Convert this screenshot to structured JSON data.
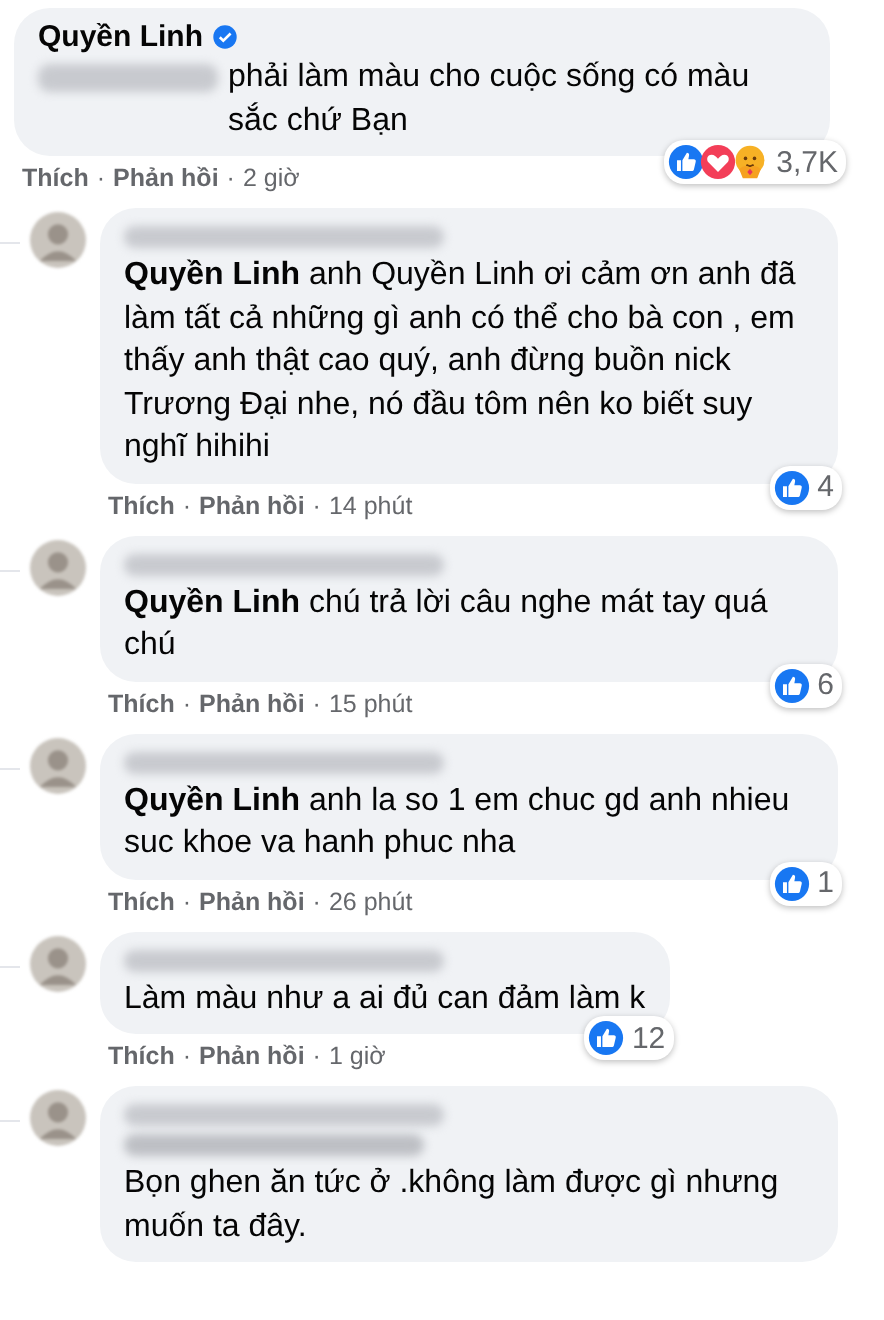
{
  "comments": [
    {
      "kind": "main",
      "author": "Quyền Linh",
      "verified": true,
      "mention_blurred": true,
      "text": "phải làm màu cho cuộc sống có màu sắc chứ Bạn",
      "reactions": [
        {
          "kind": "like"
        },
        {
          "kind": "love"
        },
        {
          "kind": "care"
        }
      ],
      "reaction_count": "3,7K",
      "actions": [
        {
          "kind": "link",
          "text": "Thích"
        },
        {
          "kind": "dot",
          "text": "·"
        },
        {
          "kind": "link",
          "text": "Phản hồi"
        },
        {
          "kind": "dot",
          "text": "·"
        },
        {
          "kind": "time",
          "text": "2 giờ"
        }
      ]
    },
    {
      "kind": "reply",
      "header": [
        {
          "kind": "blurred-name"
        }
      ],
      "text": "**Quyền Linh** anh Quyền Linh ơi cảm ơn anh đã làm tất cả những gì anh có thể cho bà con , em thấy anh thật cao quý, anh đừng buồn nick Trương Đại nhe, nó đầu tôm nên ko biết suy nghĩ hihihi",
      "reactions": [
        {
          "kind": "like"
        }
      ],
      "reaction_count": "4",
      "actions": [
        {
          "kind": "link",
          "text": "Thích"
        },
        {
          "kind": "dot",
          "text": "·"
        },
        {
          "kind": "link",
          "text": "Phản hồi"
        },
        {
          "kind": "dot",
          "text": "·"
        },
        {
          "kind": "time",
          "text": "14 phút"
        }
      ]
    },
    {
      "kind": "reply",
      "header": [
        {
          "kind": "blurred-name"
        }
      ],
      "text": "**Quyền Linh** chú trả lời câu nghe mát tay quá chú",
      "reactions": [
        {
          "kind": "like"
        }
      ],
      "reaction_count": "6",
      "actions": [
        {
          "kind": "link",
          "text": "Thích"
        },
        {
          "kind": "dot",
          "text": "·"
        },
        {
          "kind": "link",
          "text": "Phản hồi"
        },
        {
          "kind": "dot",
          "text": "·"
        },
        {
          "kind": "time",
          "text": "15 phút"
        }
      ]
    },
    {
      "kind": "reply",
      "header": [
        {
          "kind": "blurred-name"
        }
      ],
      "text": "**Quyền Linh** anh la so 1 em chuc gd anh nhieu suc khoe va hanh phuc nha",
      "reactions": [
        {
          "kind": "like"
        }
      ],
      "reaction_count": "1",
      "actions": [
        {
          "kind": "link",
          "text": "Thích"
        },
        {
          "kind": "dot",
          "text": "·"
        },
        {
          "kind": "link",
          "text": "Phản hồi"
        },
        {
          "kind": "dot",
          "text": "·"
        },
        {
          "kind": "time",
          "text": "26 phút"
        }
      ]
    },
    {
      "kind": "reply",
      "header": [
        {
          "kind": "blurred-name"
        }
      ],
      "text": "Làm màu như a ai đủ can đảm làm k",
      "reactions": [
        {
          "kind": "like"
        }
      ],
      "reaction_count": "12",
      "actions": [
        {
          "kind": "link",
          "text": "Thích"
        },
        {
          "kind": "dot",
          "text": "·"
        },
        {
          "kind": "link",
          "text": "Phản hồi"
        },
        {
          "kind": "dot",
          "text": "·"
        },
        {
          "kind": "time",
          "text": "1 giờ"
        }
      ]
    },
    {
      "kind": "reply",
      "header": [
        {
          "kind": "blurred-name"
        },
        {
          "kind": "blurred-name"
        }
      ],
      "text": "Bọn ghen ăn tức ở .không làm được gì nhưng muốn ta đây."
    }
  ]
}
